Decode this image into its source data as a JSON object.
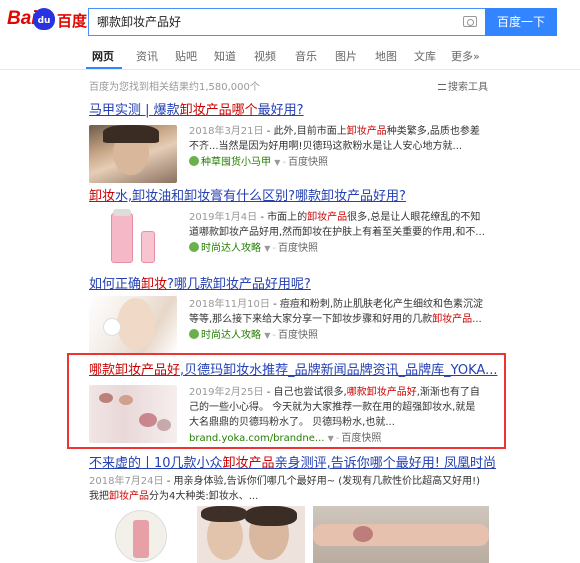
{
  "header": {
    "logo_text_left": "Bai",
    "logo_paw": "du",
    "logo_text_cn": "百度",
    "query": "哪款卸妆产品好",
    "search_button": "百度一下"
  },
  "tabs": [
    {
      "label": "网页"
    },
    {
      "label": "资讯"
    },
    {
      "label": "贴吧"
    },
    {
      "label": "知道"
    },
    {
      "label": "视频"
    },
    {
      "label": "音乐"
    },
    {
      "label": "图片"
    },
    {
      "label": "地图"
    },
    {
      "label": "文库"
    },
    {
      "label": "更多»"
    }
  ],
  "stats": "百度为您找到相关结果约1,580,000个",
  "tools": "搜索工具",
  "results": [
    {
      "title_pre": "马甲实测 | 爆款",
      "title_em": "卸妆产品哪个",
      "title_post": "最好用?",
      "date": "2018年3月21日",
      "abs_pre": " - 此外,目前市面上",
      "abs_em": "卸妆产品",
      "abs_post": "种类繁多,品质也参差不齐...当然是因为好用啊!贝德玛这款粉水是让人安心地方就...",
      "source": "种草囤货小马甲",
      "cache": "百度快照"
    },
    {
      "title_pre": "",
      "title_em": "卸妆",
      "title_post": "水,卸妆油和卸妆膏有什么区别?哪款卸妆产品好用?",
      "date": "2019年1月4日",
      "abs_pre": " - 市面上的",
      "abs_em": "卸妆产品",
      "abs_post": "很多,总是让人眼花缭乱的不知道哪款卸妆产品好用,然而卸妆在护肤上有着至关重要的作用,和不...",
      "source": "时尚达人攻略",
      "cache": "百度快照"
    },
    {
      "title_pre": "如何正确",
      "title_em": "卸妆",
      "title_post": "?哪几款卸妆产品好用呢?",
      "date": "2018年11月10日",
      "abs_pre": " - 痘痘和粉刺,防止肌肤老化产生细纹和色素沉淀等等,那么接下来给大家分享一下卸妆步骤和好用的几款",
      "abs_em": "卸妆产品",
      "abs_post": "...",
      "source": "时尚达人攻略",
      "cache": "百度快照"
    },
    {
      "title_pre": "",
      "title_em": "哪款卸妆产品好",
      "title_post": ",贝德玛卸妆水推荐_品牌新闻品牌资讯_品牌库_YOKA...",
      "date": "2019年2月25日",
      "abs_pre": " - 自己也尝试很多,",
      "abs_em": "哪款卸妆产品好",
      "abs_post": ",渐渐也有了自己的一些小心得。 今天就为大家推荐一款在用的超强卸妆水,就是大名鼎鼎的贝德玛粉水了。 贝德玛粉水,也就...",
      "source": "brand.yoka.com/brandne...",
      "cache": "百度快照"
    },
    {
      "title_pre": "不来虚的丨10几款小众",
      "title_em": "卸妆产品",
      "title_post": "亲身测评,告诉你哪个最好用! 凤凰时尚",
      "date": "2018年7月24日",
      "abs_pre": " - 用亲身体验,告诉你们哪几个最好用~ (发现有几款性价比超高又好用!) 我把",
      "abs_em": "卸妆产品",
      "abs_post": "分为4大种类:卸妆水、...",
      "source": "",
      "cache": ""
    }
  ],
  "colors": {
    "accent": "#3385ff",
    "link": "#2440b3",
    "highlight": "#cc0000",
    "frame": "#ee3333"
  }
}
